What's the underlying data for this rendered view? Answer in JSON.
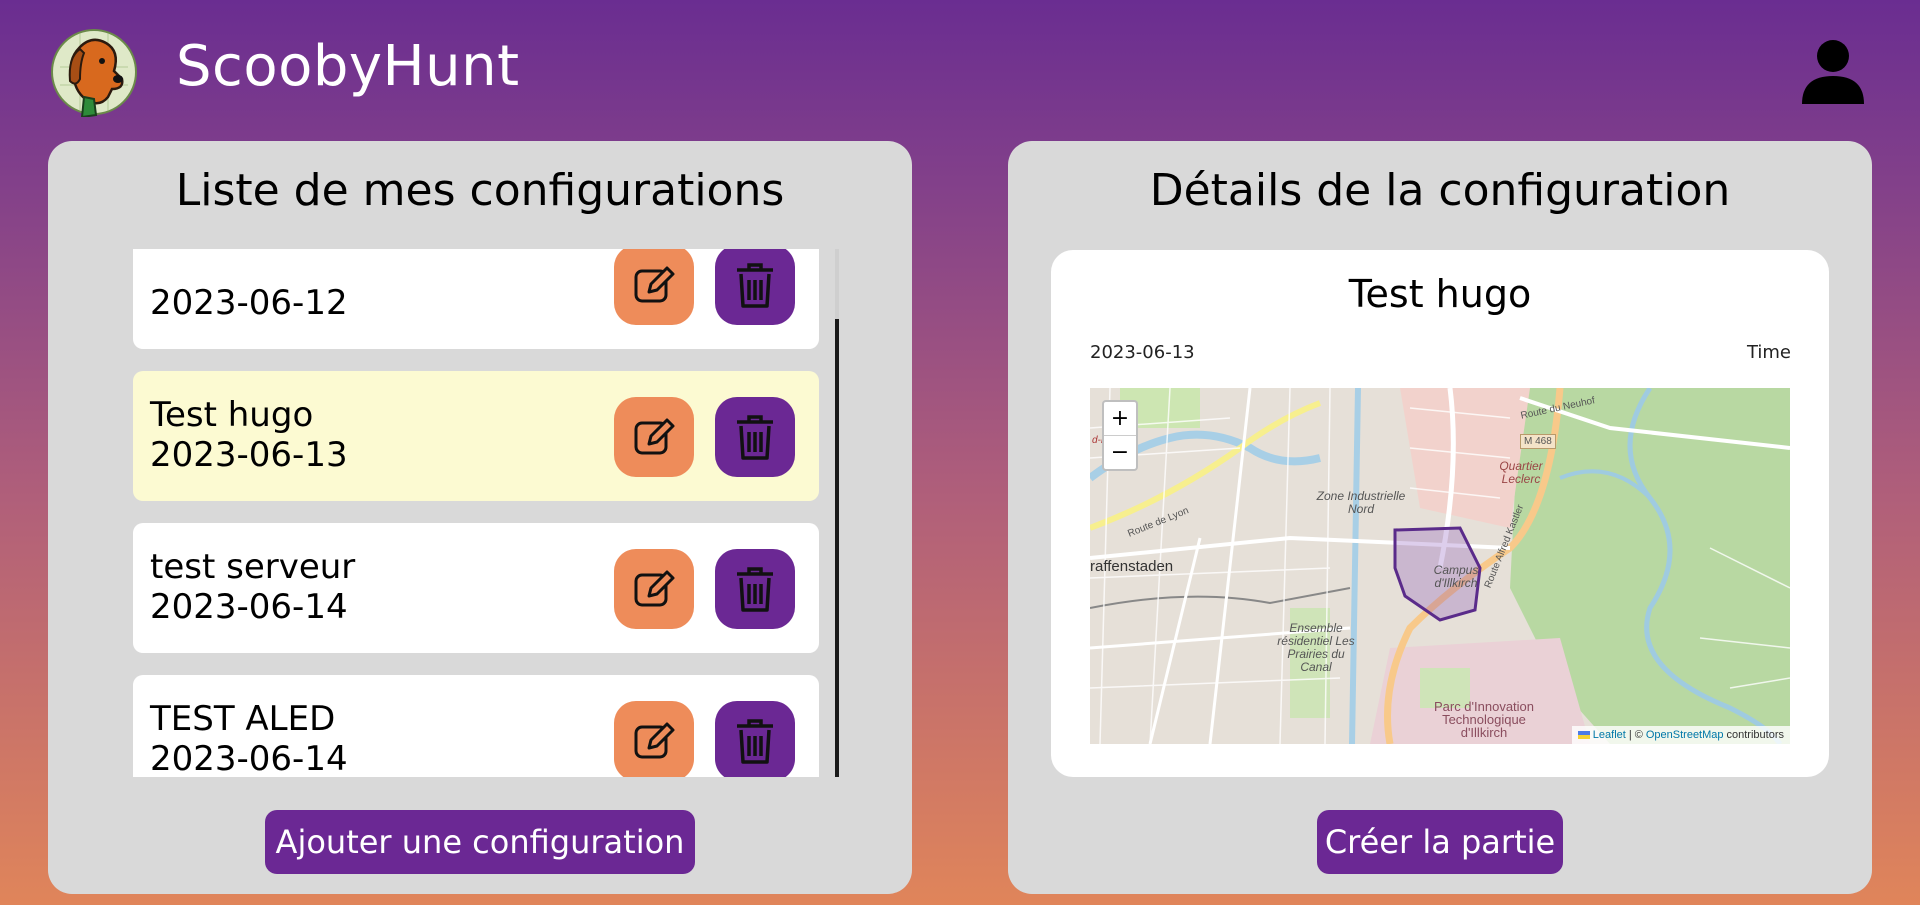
{
  "app": {
    "title": "ScoobyHunt",
    "logo_icon": "dog-logo-icon",
    "user_icon": "user-icon"
  },
  "left_panel": {
    "title": "Liste de mes configurations",
    "items": [
      {
        "name": "",
        "date": "2023-06-12",
        "selected": false
      },
      {
        "name": "Test hugo",
        "date": "2023-06-13",
        "selected": true
      },
      {
        "name": "test serveur",
        "date": "2023-06-14",
        "selected": false
      },
      {
        "name": "TEST ALED",
        "date": "2023-06-14",
        "selected": false
      }
    ],
    "edit_icon": "edit-icon",
    "delete_icon": "trash-icon",
    "add_button": "Ajouter une configuration"
  },
  "right_panel": {
    "title": "Détails de la configuration",
    "config_name": "Test hugo",
    "config_date": "2023-06-13",
    "time_label": "Time",
    "map": {
      "zoom_in": "+",
      "zoom_out": "−",
      "attribution_leaflet": "Leaflet",
      "attribution_sep": "| ©",
      "attribution_osm": "OpenStreetMap",
      "attribution_contrib": "contributors",
      "labels": {
        "route_neuhof": "Route du Neuhof",
        "m468": "M 468",
        "quartier": "Quartier Leclerc",
        "zone": "Zone Industrielle Nord",
        "route_lyon": "Route de Lyon",
        "graffenstaden": "raffenstaden",
        "campus": "Campus d'Illkirch",
        "ensemble": "Ensemble résidentiel Les Prairies du Canal",
        "parc": "Parc d'Innovation Technologique d'Illkirch",
        "route_kastler": "Route Alfred Kastler",
        "fragment": "d-Est"
      }
    },
    "create_button": "Créer la partie"
  },
  "colors": {
    "purple": "#6b2894",
    "orange": "#ee8c5a",
    "panel": "#d9d9d9",
    "selected": "#fcfad2"
  }
}
